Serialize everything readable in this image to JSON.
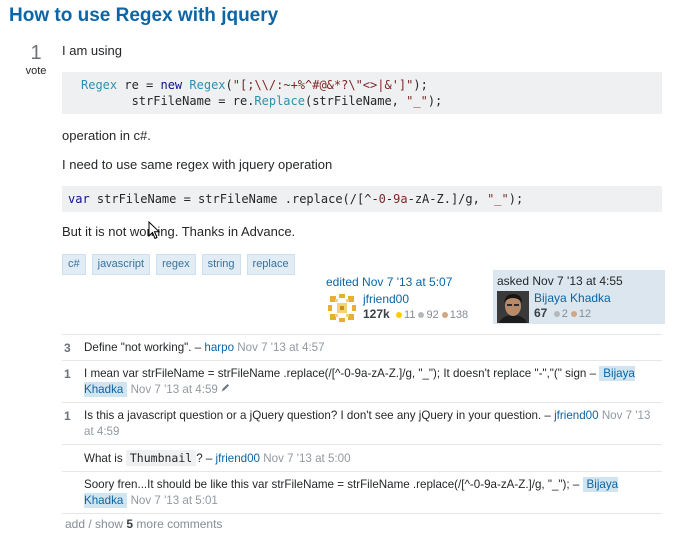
{
  "question": {
    "title": "How to use Regex with jquery",
    "votes": "1",
    "vote_label": "vote",
    "body": {
      "p1": "I am using",
      "code1_line1": {
        "t1": "Regex",
        "t2": " re = ",
        "t3": "new",
        "t4": " ",
        "t5": "Regex",
        "t6": "(",
        "t7": "\"[;\\\\/:~+%^#@&*?\\\"<>|&']\"",
        "t8": ");"
      },
      "code1_line2": {
        "t1": "strFileName = re.",
        "t2": "Replace",
        "t3": "(strFileName, ",
        "t4": "\"_\"",
        "t5": ");"
      },
      "p2": "operation in c#.",
      "p3": "I need to use same regex with jquery operation",
      "code2": {
        "t1": "var",
        "t2": " strFileName = strFileName .replace(/[^-",
        "t3": "0",
        "t4": "-",
        "t5": "9a",
        "t6": "-zA-Z.]/g, ",
        "t7": "\"_\"",
        "t8": ");"
      },
      "p4": "But it is not working. Thanks in Advance."
    },
    "tags": [
      "c#",
      "javascript",
      "regex",
      "string",
      "replace"
    ]
  },
  "edited": {
    "time": "edited Nov 7 '13 at 5:07",
    "user": "jfriend00",
    "rep": "127k",
    "gold": "11",
    "silver": "92",
    "bronze": "138"
  },
  "asked": {
    "time": "asked Nov 7 '13 at 4:55",
    "user": "Bijaya Khadka",
    "rep": "67",
    "silver": "2",
    "bronze": "12"
  },
  "comments": [
    {
      "score": "3",
      "text": "Define \"not working\". – ",
      "user": "harpo",
      "date": "Nov 7 '13 at 4:57"
    },
    {
      "score": "1",
      "text": "I mean var strFileName = strFileName .replace(/[^-0-9a-zA-Z.]/g, \"_\"); It doesn't replace \"-\",\"(\" sign – ",
      "user": "Bijaya Khadka",
      "date": "Nov 7 '13 at 4:59"
    },
    {
      "score": "1",
      "text": "Is this a javascript question or a jQuery question? I don't see any jQuery in your question. – ",
      "user": "jfriend00",
      "date": "Nov 7 '13 at 4:59"
    },
    {
      "score": "",
      "text_before": "What is ",
      "code": "Thumbnail",
      "text_after": "? – ",
      "user": "jfriend00",
      "date": "Nov 7 '13 at 5:00"
    },
    {
      "score": "",
      "text": "Soory fren...It should be like this var strFileName = strFileName .replace(/[^-0-9a-zA-Z.]/g, \"_\"); – ",
      "user": "Bijaya Khadka",
      "date": "Nov 7 '13 at 5:01"
    }
  ],
  "more_comments": {
    "prefix": "add / show ",
    "count": "5",
    "suffix": " more comments"
  },
  "colors": {
    "link": "#0c65a5",
    "tag_bg": "#e1ecf4",
    "owner_bg": "#dbe6ee",
    "code_bg": "#eff0f1"
  }
}
